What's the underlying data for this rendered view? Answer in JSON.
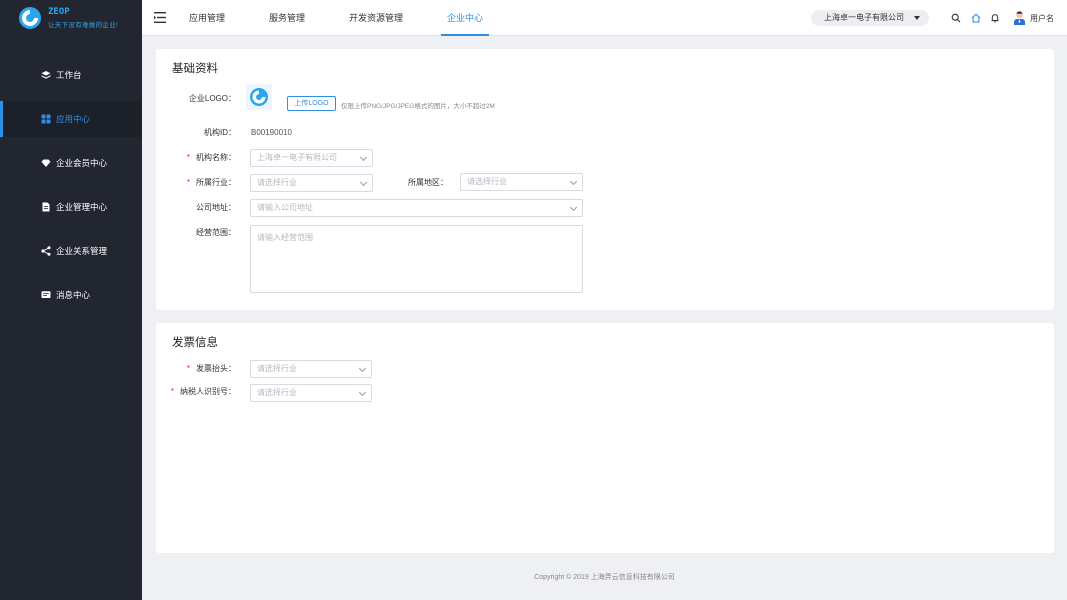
{
  "logo": {
    "title": "ZEOP",
    "slogan": "让天下没有难做的企业!"
  },
  "sidebar": {
    "items": [
      {
        "label": "工作台",
        "icon": "layers-icon",
        "active": false
      },
      {
        "label": "应用中心",
        "icon": "grid-icon",
        "active": true
      },
      {
        "label": "企业会员中心",
        "icon": "diamond-icon",
        "active": false
      },
      {
        "label": "企业管理中心",
        "icon": "document-icon",
        "active": false
      },
      {
        "label": "企业关系管理",
        "icon": "share-icon",
        "active": false
      },
      {
        "label": "消息中心",
        "icon": "message-icon",
        "active": false
      }
    ]
  },
  "header": {
    "tabs": [
      {
        "label": "应用管理",
        "active": false
      },
      {
        "label": "服务管理",
        "active": false
      },
      {
        "label": "开发资源管理",
        "active": false
      },
      {
        "label": "企业中心",
        "active": true
      }
    ],
    "company": "上海卓一电子有限公司",
    "username": "用户名"
  },
  "basic": {
    "title": "基础资料",
    "logo_label": "企业LOGO：",
    "upload_label": "上传LOGO",
    "upload_hint": "仅限上传PNG/JPG/JPEG格式的图片，大小不超过2M",
    "org_id_label": "机构ID：",
    "org_id_value": "B00190010",
    "org_name_label": "机构名称：",
    "org_name_value": "上海卓一电子有限公司",
    "industry_label": "所属行业：",
    "industry_placeholder": "请选择行业",
    "region_label": "所属地区：",
    "region_placeholder": "请选择行业",
    "address_label": "公司地址：",
    "address_placeholder": "请输入公司地址",
    "scope_label": "经营范围：",
    "scope_placeholder": "请输入经营范围"
  },
  "invoice": {
    "title": "发票信息",
    "header_label": "发票抬头：",
    "header_placeholder": "请选择行业",
    "taxid_label": "纳税人识别号：",
    "taxid_placeholder": "请选择行业"
  },
  "required_mark": "*",
  "footer": {
    "copyright": "Copyright © 2019 上海弄云信息科技有限公司"
  },
  "colors": {
    "accent": "#2f8fe6",
    "sidebar_bg": "#222631",
    "required": "#e02b2b"
  }
}
